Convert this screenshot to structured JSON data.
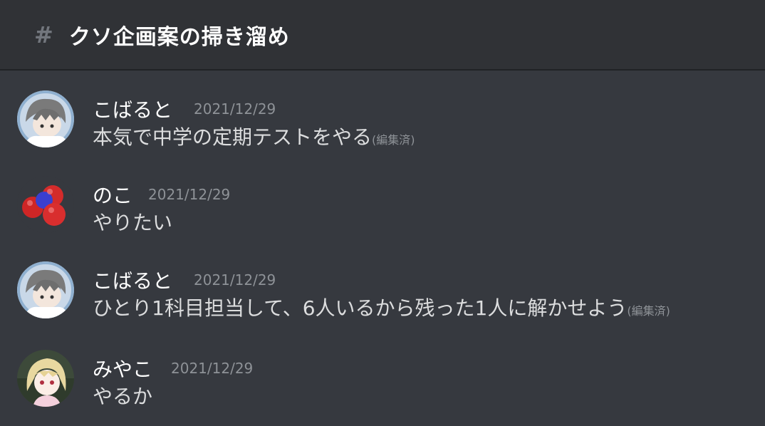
{
  "channel": {
    "hash_symbol": "#",
    "name": "クソ企画案の掃き溜め"
  },
  "messages": [
    {
      "author": "こばると",
      "timestamp": "2021/12/29",
      "text": "本気で中学の定期テストをやる",
      "edited": "(編集済)",
      "avatar": "kobaruto-avatar"
    },
    {
      "author": "のこ",
      "timestamp": "2021/12/29",
      "text": "やりたい",
      "edited": "",
      "avatar": "molecule-avatar"
    },
    {
      "author": "こばると",
      "timestamp": "2021/12/29",
      "text": "ひとり1科目担当して、6人いるから残った1人に解かせよう",
      "edited": "(編集済)",
      "avatar": "kobaruto-avatar"
    },
    {
      "author": "みやこ",
      "timestamp": "2021/12/29",
      "text": "やるか",
      "edited": "",
      "avatar": "miyako-avatar"
    }
  ],
  "colors": {
    "background": "#36393f",
    "header": "#303236",
    "username": "#ffffff",
    "message_text": "#dcddde",
    "timestamp": "#8e9297"
  }
}
